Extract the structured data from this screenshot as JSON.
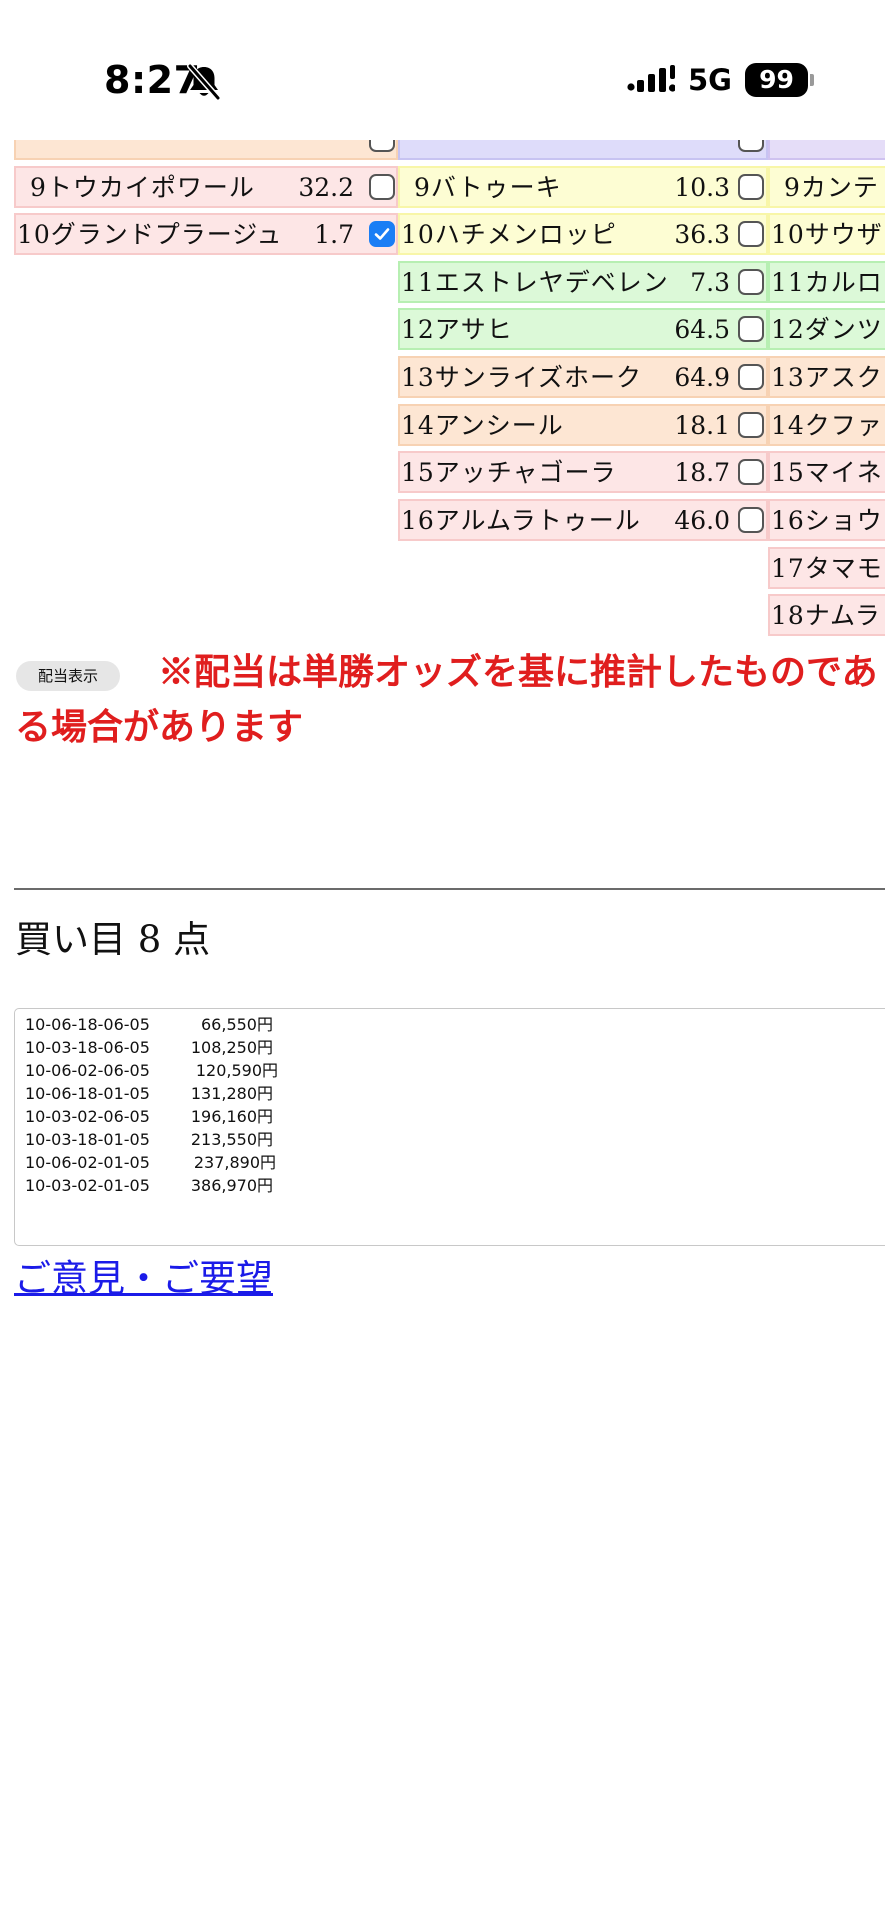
{
  "status_bar": {
    "time": "8:27",
    "network": "5G",
    "battery": "99",
    "icons": [
      "bell-slash-icon",
      "signal-icon",
      "battery-icon"
    ]
  },
  "horses": {
    "column_1": [
      {
        "label": "9トウカイポワール",
        "odds": "32.2",
        "checked": false
      },
      {
        "label": "10グランドプラージュ",
        "odds": "1.7",
        "checked": true
      }
    ],
    "column_2": [
      {
        "label": "9バトゥーキ",
        "odds": "10.3",
        "checked": false
      },
      {
        "label": "10ハチメンロッピ",
        "odds": "36.3",
        "checked": false
      },
      {
        "label": "11エストレヤデベレン",
        "odds": "7.3",
        "checked": false
      },
      {
        "label": "12アサヒ",
        "odds": "64.5",
        "checked": false
      },
      {
        "label": "13サンライズホーク",
        "odds": "64.9",
        "checked": false
      },
      {
        "label": "14アンシール",
        "odds": "18.1",
        "checked": false
      },
      {
        "label": "15アッチャゴーラ",
        "odds": "18.7",
        "checked": false
      },
      {
        "label": "16アルムラトゥール",
        "odds": "46.0",
        "checked": false
      }
    ],
    "column_3": [
      {
        "label": "9カンテ"
      },
      {
        "label": "10サウザ"
      },
      {
        "label": "11カルロ"
      },
      {
        "label": "12ダンツ"
      },
      {
        "label": "13アスク"
      },
      {
        "label": "14クファ"
      },
      {
        "label": "15マイネ"
      },
      {
        "label": "16ショウ"
      },
      {
        "label": "17タマモ"
      },
      {
        "label": "18ナムラ"
      }
    ]
  },
  "payout": {
    "button_label": "配当表示",
    "notice_line1": "※配当は単勝オッズを基に推計したものであ",
    "notice_line2": "る場合があります"
  },
  "result": {
    "heading": "買い目 8 点",
    "lines": [
      {
        "combo": "10-06-18-06-05",
        "amount": "66,550円"
      },
      {
        "combo": "10-03-18-06-05",
        "amount": "108,250円"
      },
      {
        "combo": "10-06-02-06-05",
        "amount": "120,590円"
      },
      {
        "combo": "10-06-18-01-05",
        "amount": "131,280円"
      },
      {
        "combo": "10-03-02-06-05",
        "amount": "196,160円"
      },
      {
        "combo": "10-03-18-01-05",
        "amount": "213,550円"
      },
      {
        "combo": "10-06-02-01-05",
        "amount": "237,890円"
      },
      {
        "combo": "10-03-02-01-05",
        "amount": "386,970円"
      }
    ]
  },
  "feedback_link": "ご意見・ご要望",
  "colors": {
    "notice_red": "#e01e1e",
    "link_blue": "#1b1be8",
    "checkbox_blue": "#1a7ef5",
    "row_red": "#fde6e6",
    "row_yellow": "#fdfdd3",
    "row_green": "#dcf9d8",
    "row_orange": "#fde6d3",
    "row_blue": "#dedcfa"
  }
}
